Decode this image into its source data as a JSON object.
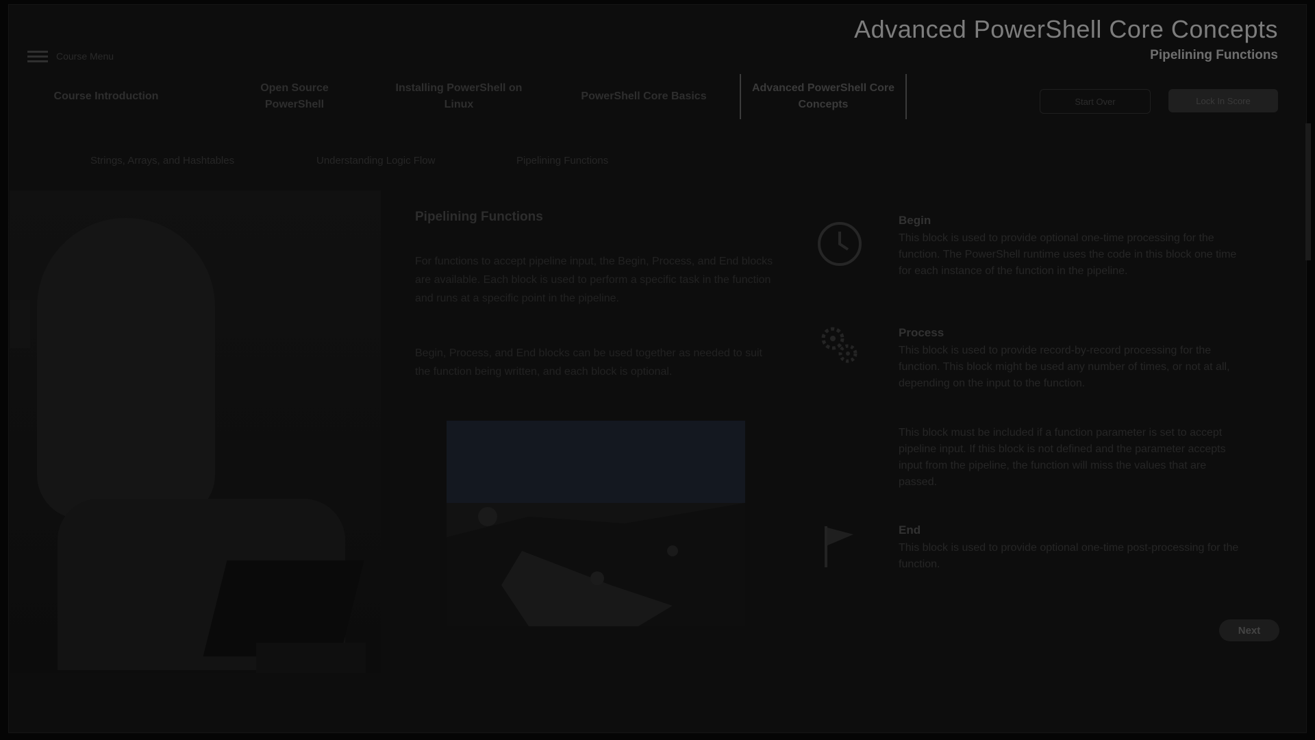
{
  "course": {
    "title": "Advanced PowerShell Core Concepts",
    "subtitle": "Pipelining Functions"
  },
  "menu": {
    "label": "Course Menu"
  },
  "tabs": [
    {
      "label": "Course Introduction"
    },
    {
      "label": "Open Source PowerShell"
    },
    {
      "label": "Installing PowerShell on Linux"
    },
    {
      "label": "PowerShell Core Basics"
    },
    {
      "label": "Advanced PowerShell Core Concepts"
    }
  ],
  "actions": {
    "start_over": "Start Over",
    "lock_in": "Lock In Score"
  },
  "subtabs": [
    {
      "label": "Strings, Arrays, and Hashtables"
    },
    {
      "label": "Understanding Logic Flow"
    },
    {
      "label": "Pipelining Functions"
    }
  ],
  "content": {
    "title": "Pipelining Functions",
    "paragraph1": "For functions to accept pipeline input, the Begin, Process, and End blocks are available. Each block is used to perform a specific task in the function and runs at a specific point in the pipeline.",
    "paragraph2": "Begin, Process, and End blocks can be used together as needed to suit the function being written, and each block is optional."
  },
  "steps": [
    {
      "title": "Begin",
      "text": "This block is used to provide optional one-time processing for the function. The PowerShell runtime uses the code in this block one time for each instance of the function in the pipeline.",
      "icon": "clock-icon"
    },
    {
      "title": "Process",
      "text": "This block is used to provide record-by-record processing for the function. This block might be used any number of times, or not at all, depending on the input to the function.",
      "text2": "This block must be included if a function parameter is set to accept pipeline input. If this block is not defined and the parameter accepts input from the pipeline, the function will miss the values that are passed.",
      "icon": "gears-icon"
    },
    {
      "title": "End",
      "text": "This block is used to provide optional one-time post-processing for the function.",
      "icon": "flag-icon"
    }
  ],
  "next": {
    "label": "Next"
  }
}
